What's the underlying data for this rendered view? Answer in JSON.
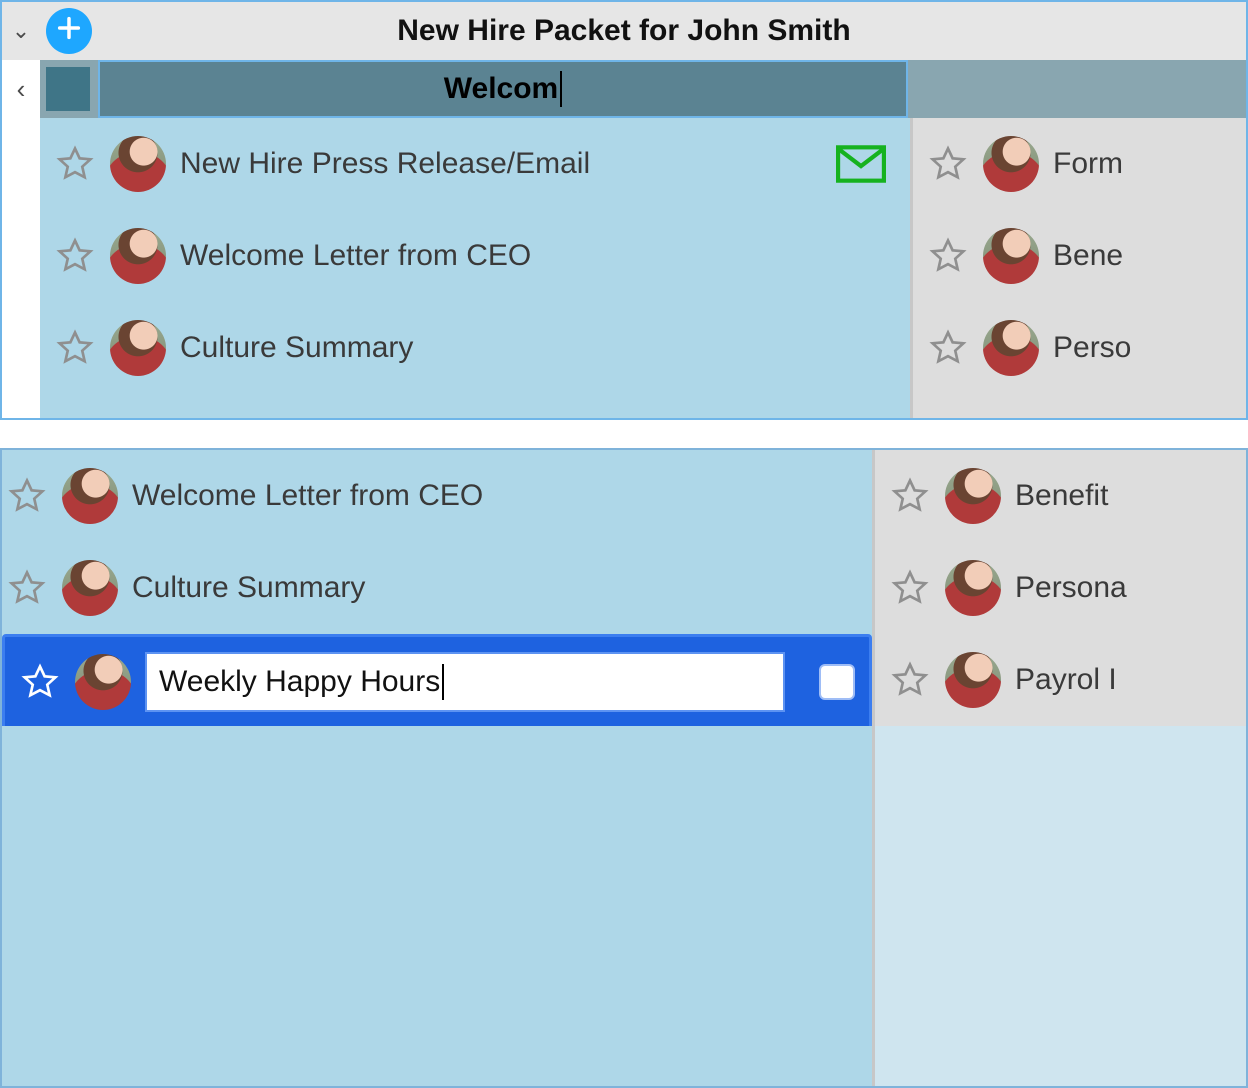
{
  "header": {
    "title": "New Hire Packet for John Smith",
    "column_edit_value": "Welcom"
  },
  "panel1": {
    "columnA": [
      {
        "label": "New Hire Press Release/Email",
        "mail": true
      },
      {
        "label": "Welcome Letter from CEO"
      },
      {
        "label": "Culture Summary"
      }
    ],
    "columnB": [
      {
        "label": "Form"
      },
      {
        "label": "Bene"
      },
      {
        "label": "Perso"
      }
    ]
  },
  "panel2": {
    "columnA_top": [
      {
        "label": "Welcome Letter from CEO"
      },
      {
        "label": "Culture Summary"
      }
    ],
    "editing_value": "Weekly Happy Hours",
    "columnB": [
      {
        "label": "Benefit"
      },
      {
        "label": "Persona"
      },
      {
        "label": "Payrol I"
      }
    ]
  },
  "icons": {
    "chevron_down": "⌄",
    "chevron_left": "‹"
  }
}
